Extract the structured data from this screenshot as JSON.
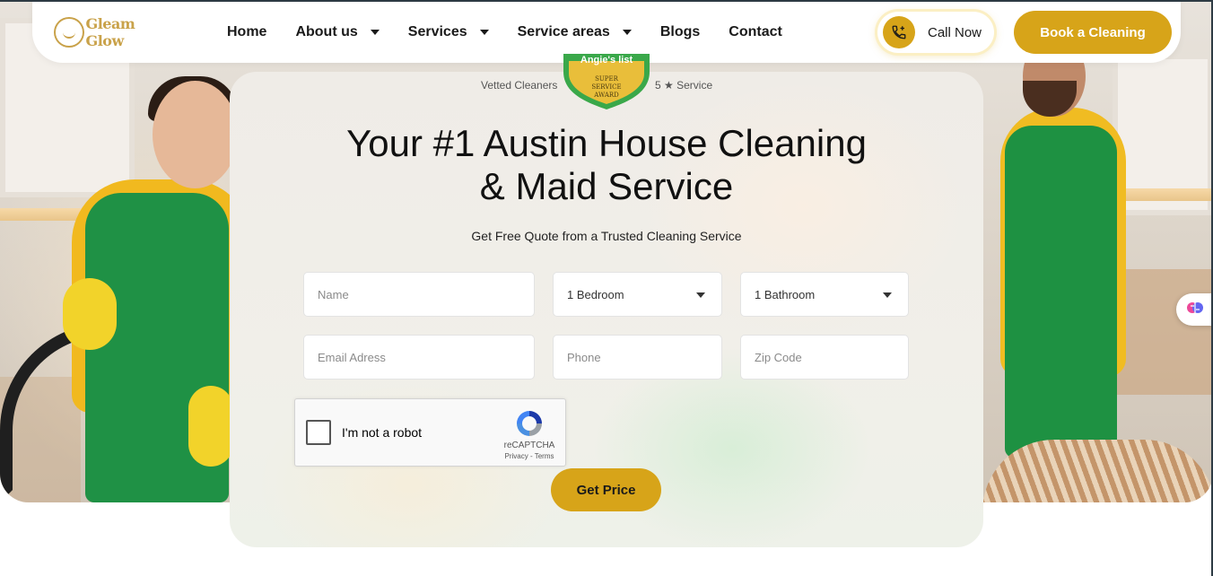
{
  "brand": {
    "logo_text": "Gleam Glow"
  },
  "nav": {
    "items": [
      {
        "label": "Home",
        "has_dropdown": false
      },
      {
        "label": "About us",
        "has_dropdown": true
      },
      {
        "label": "Services",
        "has_dropdown": true
      },
      {
        "label": "Service areas",
        "has_dropdown": true
      },
      {
        "label": "Blogs",
        "has_dropdown": false
      },
      {
        "label": "Contact",
        "has_dropdown": false
      }
    ]
  },
  "header": {
    "call_label": "Call Now",
    "book_label": "Book a Cleaning"
  },
  "badges": {
    "left": "Vetted Cleaners",
    "right": "5 ★ Service",
    "award_top": "Angie's list",
    "award_lines": [
      "SUPER",
      "SERVICE",
      "AWARD"
    ]
  },
  "hero": {
    "headline_line1": "Your #1 Austin House Cleaning",
    "headline_line2": "& Maid Service",
    "subline": "Get Free Quote from a Trusted Cleaning Service"
  },
  "form": {
    "name_placeholder": "Name",
    "bedrooms_value": "1 Bedroom",
    "bathrooms_value": "1 Bathroom",
    "email_placeholder": "Email Adress",
    "phone_placeholder": "Phone",
    "zip_placeholder": "Zip Code",
    "submit_label": "Get Price"
  },
  "recaptcha": {
    "label": "I'm not a robot",
    "brand": "reCAPTCHA",
    "terms": "Privacy - Terms"
  },
  "colors": {
    "accent": "#d7a419",
    "logo_gold": "#c9a24a",
    "apron_green": "#1f9145",
    "award_green": "#3aa84a"
  },
  "icons": [
    "phone-icon",
    "caret-down-icon",
    "recaptcha-icon",
    "brain-icon"
  ]
}
